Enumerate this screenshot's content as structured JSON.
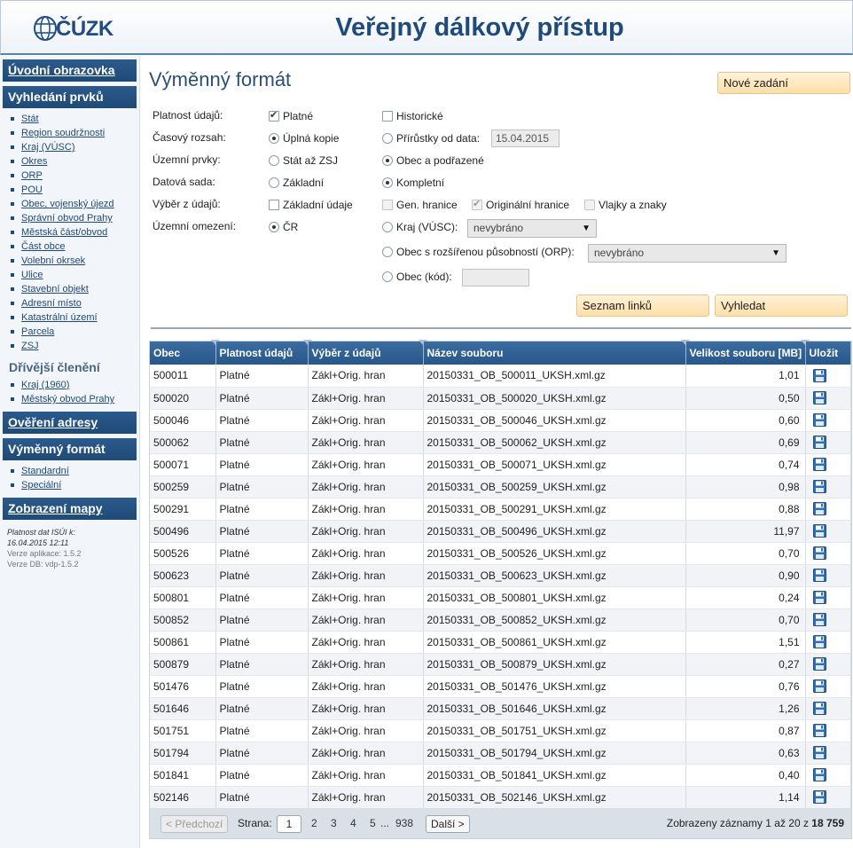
{
  "header": {
    "logo_text": "ČÚZK",
    "title": "Veřejný dálkový přístup"
  },
  "sidebar": {
    "home": "Úvodní obrazovka",
    "search_head": "Vyhledání prvků",
    "search_items": [
      "Stát",
      "Region soudržnosti",
      "Kraj (VÚSC)",
      "Okres",
      "ORP",
      "POU",
      "Obec, vojenský újezd",
      "Správní obvod Prahy",
      "Městská část/obvod",
      "Část obce",
      "Volební okrsek",
      "Ulice",
      "Stavební objekt",
      "Adresní místo",
      "Katastrální území",
      "Parcela",
      "ZSJ"
    ],
    "former_head": "Dřívější členění",
    "former_items": [
      "Kraj (1960)",
      "Městský obvod Prahy"
    ],
    "address_check": "Ověření adresy",
    "exchange_head": "Výměnný formát",
    "exchange_items": [
      "Standardní",
      "Speciální"
    ],
    "map": "Zobrazení mapy",
    "info_validity_label": "Platnost dat ISÚI k:",
    "info_validity_value": "16.04.2015 12:11",
    "info_app_version": "Verze aplikace: 1.5.2",
    "info_db_version": "Verze DB: vdp-1.5.2"
  },
  "form": {
    "title": "Výměnný formát",
    "new_query": "Nové zadání",
    "labels": {
      "validity": "Platnost údajů:",
      "time": "Časový rozsah:",
      "territory": "Územní prvky:",
      "dataset": "Datová sada:",
      "selection": "Výběr z údajů:",
      "restriction": "Územní omezení:"
    },
    "options": {
      "valid": "Platné",
      "historic": "Historické",
      "full_copy": "Úplná kopie",
      "increments": "Přírůstky od data:",
      "increments_date": "15.04.2015",
      "state_to_zsj": "Stát až ZSJ",
      "municipality_sub": "Obec a podřazené",
      "basic": "Základní",
      "complete": "Kompletní",
      "basic_data": "Základní údaje",
      "gen_borders": "Gen. hranice",
      "orig_borders": "Originální hranice",
      "flags": "Vlajky a znaky",
      "cr": "ČR",
      "region": "Kraj (VÚSC):",
      "region_value": "nevybráno",
      "orp": "Obec s rozšířenou působností (ORP):",
      "orp_value": "nevybráno",
      "municipality_code": "Obec (kód):"
    },
    "links_button": "Seznam linků",
    "search_button": "Vyhledat"
  },
  "grid": {
    "columns": [
      "Obec",
      "Platnost údajů",
      "Výběr z údajů",
      "Název souboru",
      "Velikost souboru [MB]",
      "Uložit"
    ],
    "rows": [
      [
        "500011",
        "Platné",
        "Zákl+Orig. hran",
        "20150331_OB_500011_UKSH.xml.gz",
        "1,01"
      ],
      [
        "500020",
        "Platné",
        "Zákl+Orig. hran",
        "20150331_OB_500020_UKSH.xml.gz",
        "0,50"
      ],
      [
        "500046",
        "Platné",
        "Zákl+Orig. hran",
        "20150331_OB_500046_UKSH.xml.gz",
        "0,60"
      ],
      [
        "500062",
        "Platné",
        "Zákl+Orig. hran",
        "20150331_OB_500062_UKSH.xml.gz",
        "0,69"
      ],
      [
        "500071",
        "Platné",
        "Zákl+Orig. hran",
        "20150331_OB_500071_UKSH.xml.gz",
        "0,74"
      ],
      [
        "500259",
        "Platné",
        "Zákl+Orig. hran",
        "20150331_OB_500259_UKSH.xml.gz",
        "0,98"
      ],
      [
        "500291",
        "Platné",
        "Zákl+Orig. hran",
        "20150331_OB_500291_UKSH.xml.gz",
        "0,88"
      ],
      [
        "500496",
        "Platné",
        "Zákl+Orig. hran",
        "20150331_OB_500496_UKSH.xml.gz",
        "11,97"
      ],
      [
        "500526",
        "Platné",
        "Zákl+Orig. hran",
        "20150331_OB_500526_UKSH.xml.gz",
        "0,70"
      ],
      [
        "500623",
        "Platné",
        "Zákl+Orig. hran",
        "20150331_OB_500623_UKSH.xml.gz",
        "0,90"
      ],
      [
        "500801",
        "Platné",
        "Zákl+Orig. hran",
        "20150331_OB_500801_UKSH.xml.gz",
        "0,24"
      ],
      [
        "500852",
        "Platné",
        "Zákl+Orig. hran",
        "20150331_OB_500852_UKSH.xml.gz",
        "0,70"
      ],
      [
        "500861",
        "Platné",
        "Zákl+Orig. hran",
        "20150331_OB_500861_UKSH.xml.gz",
        "1,51"
      ],
      [
        "500879",
        "Platné",
        "Zákl+Orig. hran",
        "20150331_OB_500879_UKSH.xml.gz",
        "0,27"
      ],
      [
        "501476",
        "Platné",
        "Zákl+Orig. hran",
        "20150331_OB_501476_UKSH.xml.gz",
        "0,76"
      ],
      [
        "501646",
        "Platné",
        "Zákl+Orig. hran",
        "20150331_OB_501646_UKSH.xml.gz",
        "1,26"
      ],
      [
        "501751",
        "Platné",
        "Zákl+Orig. hran",
        "20150331_OB_501751_UKSH.xml.gz",
        "0,87"
      ],
      [
        "501794",
        "Platné",
        "Zákl+Orig. hran",
        "20150331_OB_501794_UKSH.xml.gz",
        "0,63"
      ],
      [
        "501841",
        "Platné",
        "Zákl+Orig. hran",
        "20150331_OB_501841_UKSH.xml.gz",
        "0,40"
      ],
      [
        "502146",
        "Platné",
        "Zákl+Orig. hran",
        "20150331_OB_502146_UKSH.xml.gz",
        "1,14"
      ]
    ]
  },
  "pager": {
    "prev": "< Předchozí",
    "page_label": "Strana:",
    "current": "1",
    "pages": [
      "2",
      "3",
      "4",
      "5"
    ],
    "ellipsis": "...",
    "last": "938",
    "next": "Další >",
    "info_prefix": "Zobrazeny záznamy 1 až 20 z",
    "total": "18 759"
  },
  "colors": {
    "accent": "#1f4a77",
    "button_orange": "#ffdfa8",
    "header_title": "#1f4a7c"
  }
}
